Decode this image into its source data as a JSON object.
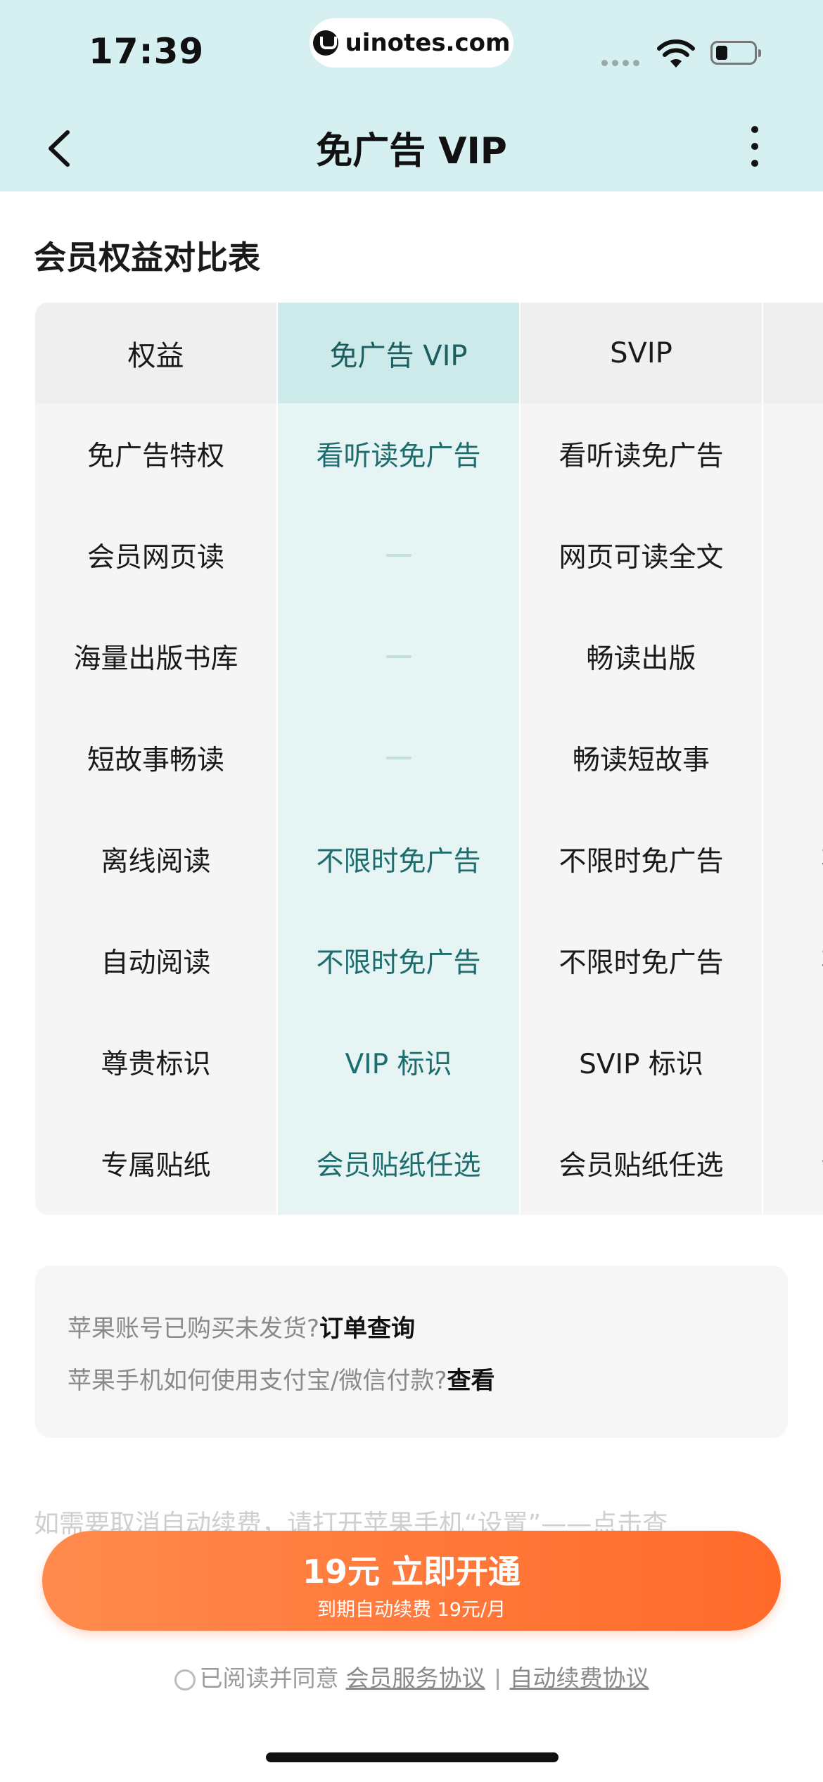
{
  "status_bar": {
    "time": "17:39",
    "url": "uinotes.com"
  },
  "nav": {
    "title": "免广告 VIP"
  },
  "section_title": "会员权益对比表",
  "table": {
    "headers": [
      "权益",
      "免广告 VIP",
      "SVIP",
      ""
    ],
    "rows": [
      {
        "benefit": "免广告特权",
        "vip": "看听读免广告",
        "svip": "看听读免广告",
        "extra": ""
      },
      {
        "benefit": "会员网页读",
        "vip": "",
        "svip": "网页可读全文",
        "extra": ""
      },
      {
        "benefit": "海量出版书库",
        "vip": "",
        "svip": "畅读出版",
        "extra": ""
      },
      {
        "benefit": "短故事畅读",
        "vip": "",
        "svip": "畅读短故事",
        "extra": ""
      },
      {
        "benefit": "离线阅读",
        "vip": "不限时免广告",
        "svip": "不限时免广告",
        "extra": "不"
      },
      {
        "benefit": "自动阅读",
        "vip": "不限时免广告",
        "svip": "不限时免广告",
        "extra": "不"
      },
      {
        "benefit": "尊贵标识",
        "vip": "VIP 标识",
        "svip": "SVIP 标识",
        "extra": ""
      },
      {
        "benefit": "专属贴纸",
        "vip": "会员贴纸任选",
        "svip": "会员贴纸任选",
        "extra": "会"
      }
    ]
  },
  "info": {
    "line1_text": "苹果账号已购买未发货?",
    "line1_link": "订单查询",
    "line2_text": "苹果手机如何使用支付宝/微信付款?",
    "line2_link": "查看"
  },
  "cancel_note": "如需要取消自动续费，请打开苹果手机“设置”——点击查",
  "subscribe": {
    "main": "19元 立即开通",
    "sub": "到期自动续费 19元/月"
  },
  "agreement": {
    "prefix": "已阅读并同意",
    "link1": "会员服务协议",
    "link2": "自动续费协议"
  }
}
